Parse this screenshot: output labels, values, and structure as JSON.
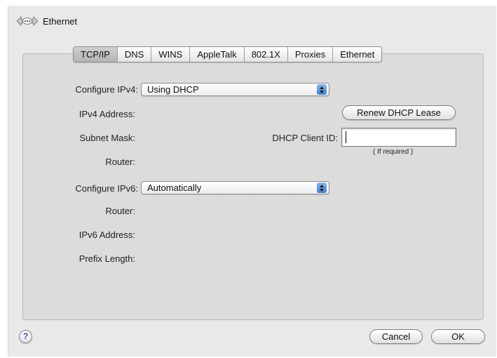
{
  "header": {
    "icon": "ethernet-icon",
    "title": "Ethernet"
  },
  "tabs": [
    {
      "label": "TCP/IP",
      "active": true
    },
    {
      "label": "DNS",
      "active": false
    },
    {
      "label": "WINS",
      "active": false
    },
    {
      "label": "AppleTalk",
      "active": false
    },
    {
      "label": "802.1X",
      "active": false
    },
    {
      "label": "Proxies",
      "active": false
    },
    {
      "label": "Ethernet",
      "active": false
    }
  ],
  "ipv4": {
    "configure_label": "Configure IPv4:",
    "configure_value": "Using DHCP",
    "address_label": "IPv4 Address:",
    "subnet_label": "Subnet Mask:",
    "router_label": "Router:"
  },
  "dhcp": {
    "renew_label": "Renew DHCP Lease",
    "client_id_label": "DHCP Client ID:",
    "client_id_value": "",
    "client_id_hint": "( If required )"
  },
  "ipv6": {
    "configure_label": "Configure IPv6:",
    "configure_value": "Automatically",
    "router_label": "Router:",
    "address_label": "IPv6 Address:",
    "prefix_label": "Prefix Length:"
  },
  "footer": {
    "help_glyph": "?",
    "cancel_label": "Cancel",
    "ok_label": "OK"
  },
  "colors": {
    "window_bg": "#e9e9e9",
    "group_bg": "#dcdcdc",
    "stepper_accent": "#3f7fd4"
  }
}
